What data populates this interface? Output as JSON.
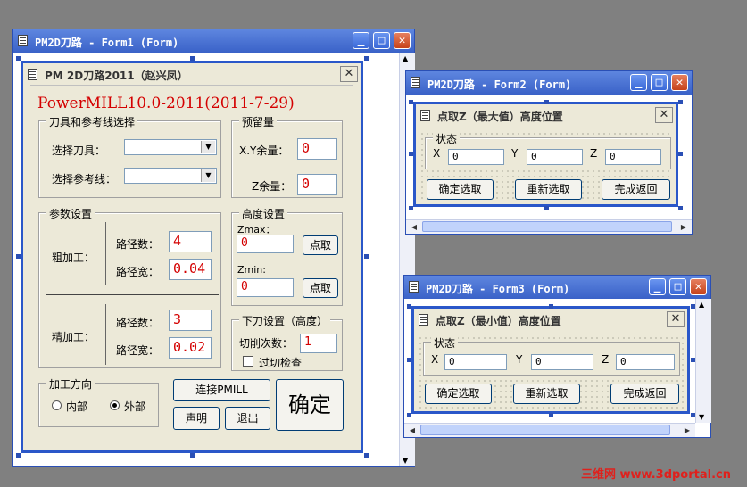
{
  "win1": {
    "title": "PM2D刀路 - Form1 (Form)",
    "form": {
      "title": "PM 2D刀路2011（赵兴凤）",
      "banner": "PowerMILL10.0-2011(2011-7-29)",
      "tool_frame": {
        "label": "刀具和参考线选择",
        "select_tool_label": "选择刀具：",
        "select_ref_label": "选择参考线："
      },
      "stock_frame": {
        "label": "预留量",
        "xy_label": "X.Y余量：",
        "xy_value": "0",
        "z_label": "Z余量：",
        "z_value": "0"
      },
      "params_frame": {
        "label": "参数设置",
        "rough_label": "粗加工：",
        "rough_count_label": "路径数：",
        "rough_count": "4",
        "rough_width_label": "路径宽：",
        "rough_width": "0.04",
        "finish_label": "精加工：",
        "finish_count_label": "路径数：",
        "finish_count": "3",
        "finish_width_label": "路径宽：",
        "finish_width": "0.02"
      },
      "height_frame": {
        "label": "高度设置",
        "zmax_label": "Zmax：",
        "zmax_value": "0",
        "zmin_label": "Zmin:",
        "zmin_value": "0",
        "pick_label": "点取"
      },
      "plunge_frame": {
        "label": "下刀设置（高度）",
        "cuts_label": "切削次数：",
        "cuts_value": "1",
        "overcut_label": "过切检查"
      },
      "direction_frame": {
        "label": "加工方向",
        "inner": "内部",
        "outer": "外部",
        "selected": "外部"
      },
      "connect_btn": "连接PMILL",
      "declare_btn": "声明",
      "exit_btn": "退出",
      "ok_btn": "确定"
    }
  },
  "win2": {
    "title": "PM2D刀路 - Form2 (Form)",
    "form": {
      "title": "点取Z（最大值）高度位置",
      "status_label": "状态",
      "x_label": "X",
      "x_value": "0",
      "y_label": "Y",
      "y_value": "0",
      "z_label": "Z",
      "z_value": "0",
      "confirm_btn": "确定选取",
      "reselect_btn": "重新选取",
      "done_btn": "完成返回"
    }
  },
  "win3": {
    "title": "PM2D刀路 - Form3 (Form)",
    "form": {
      "title": "点取Z（最小值）高度位置",
      "status_label": "状态",
      "x_label": "X",
      "x_value": "0",
      "y_label": "Y",
      "y_value": "0",
      "z_label": "Z",
      "z_value": "0",
      "confirm_btn": "确定选取",
      "reselect_btn": "重新选取",
      "done_btn": "完成返回"
    }
  },
  "watermark": "三维网 www.3dportal.cn",
  "colors": {
    "titlebar": "#3a62c8",
    "form_border": "#2a57c9",
    "face": "#ece9d8",
    "value_red": "#d40000"
  }
}
